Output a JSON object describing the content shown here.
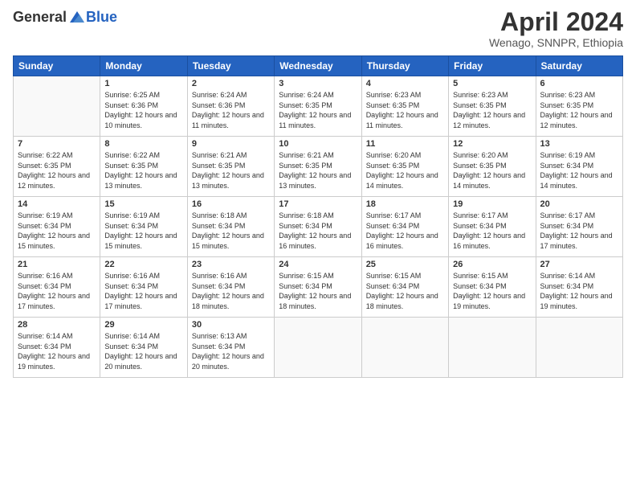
{
  "header": {
    "logo_general": "General",
    "logo_blue": "Blue",
    "main_title": "April 2024",
    "subtitle": "Wenago, SNNPR, Ethiopia"
  },
  "days_of_week": [
    "Sunday",
    "Monday",
    "Tuesday",
    "Wednesday",
    "Thursday",
    "Friday",
    "Saturday"
  ],
  "weeks": [
    [
      {
        "num": "",
        "sunrise": "",
        "sunset": "",
        "daylight": ""
      },
      {
        "num": "1",
        "sunrise": "Sunrise: 6:25 AM",
        "sunset": "Sunset: 6:36 PM",
        "daylight": "Daylight: 12 hours and 10 minutes."
      },
      {
        "num": "2",
        "sunrise": "Sunrise: 6:24 AM",
        "sunset": "Sunset: 6:36 PM",
        "daylight": "Daylight: 12 hours and 11 minutes."
      },
      {
        "num": "3",
        "sunrise": "Sunrise: 6:24 AM",
        "sunset": "Sunset: 6:35 PM",
        "daylight": "Daylight: 12 hours and 11 minutes."
      },
      {
        "num": "4",
        "sunrise": "Sunrise: 6:23 AM",
        "sunset": "Sunset: 6:35 PM",
        "daylight": "Daylight: 12 hours and 11 minutes."
      },
      {
        "num": "5",
        "sunrise": "Sunrise: 6:23 AM",
        "sunset": "Sunset: 6:35 PM",
        "daylight": "Daylight: 12 hours and 12 minutes."
      },
      {
        "num": "6",
        "sunrise": "Sunrise: 6:23 AM",
        "sunset": "Sunset: 6:35 PM",
        "daylight": "Daylight: 12 hours and 12 minutes."
      }
    ],
    [
      {
        "num": "7",
        "sunrise": "Sunrise: 6:22 AM",
        "sunset": "Sunset: 6:35 PM",
        "daylight": "Daylight: 12 hours and 12 minutes."
      },
      {
        "num": "8",
        "sunrise": "Sunrise: 6:22 AM",
        "sunset": "Sunset: 6:35 PM",
        "daylight": "Daylight: 12 hours and 13 minutes."
      },
      {
        "num": "9",
        "sunrise": "Sunrise: 6:21 AM",
        "sunset": "Sunset: 6:35 PM",
        "daylight": "Daylight: 12 hours and 13 minutes."
      },
      {
        "num": "10",
        "sunrise": "Sunrise: 6:21 AM",
        "sunset": "Sunset: 6:35 PM",
        "daylight": "Daylight: 12 hours and 13 minutes."
      },
      {
        "num": "11",
        "sunrise": "Sunrise: 6:20 AM",
        "sunset": "Sunset: 6:35 PM",
        "daylight": "Daylight: 12 hours and 14 minutes."
      },
      {
        "num": "12",
        "sunrise": "Sunrise: 6:20 AM",
        "sunset": "Sunset: 6:35 PM",
        "daylight": "Daylight: 12 hours and 14 minutes."
      },
      {
        "num": "13",
        "sunrise": "Sunrise: 6:19 AM",
        "sunset": "Sunset: 6:34 PM",
        "daylight": "Daylight: 12 hours and 14 minutes."
      }
    ],
    [
      {
        "num": "14",
        "sunrise": "Sunrise: 6:19 AM",
        "sunset": "Sunset: 6:34 PM",
        "daylight": "Daylight: 12 hours and 15 minutes."
      },
      {
        "num": "15",
        "sunrise": "Sunrise: 6:19 AM",
        "sunset": "Sunset: 6:34 PM",
        "daylight": "Daylight: 12 hours and 15 minutes."
      },
      {
        "num": "16",
        "sunrise": "Sunrise: 6:18 AM",
        "sunset": "Sunset: 6:34 PM",
        "daylight": "Daylight: 12 hours and 15 minutes."
      },
      {
        "num": "17",
        "sunrise": "Sunrise: 6:18 AM",
        "sunset": "Sunset: 6:34 PM",
        "daylight": "Daylight: 12 hours and 16 minutes."
      },
      {
        "num": "18",
        "sunrise": "Sunrise: 6:17 AM",
        "sunset": "Sunset: 6:34 PM",
        "daylight": "Daylight: 12 hours and 16 minutes."
      },
      {
        "num": "19",
        "sunrise": "Sunrise: 6:17 AM",
        "sunset": "Sunset: 6:34 PM",
        "daylight": "Daylight: 12 hours and 16 minutes."
      },
      {
        "num": "20",
        "sunrise": "Sunrise: 6:17 AM",
        "sunset": "Sunset: 6:34 PM",
        "daylight": "Daylight: 12 hours and 17 minutes."
      }
    ],
    [
      {
        "num": "21",
        "sunrise": "Sunrise: 6:16 AM",
        "sunset": "Sunset: 6:34 PM",
        "daylight": "Daylight: 12 hours and 17 minutes."
      },
      {
        "num": "22",
        "sunrise": "Sunrise: 6:16 AM",
        "sunset": "Sunset: 6:34 PM",
        "daylight": "Daylight: 12 hours and 17 minutes."
      },
      {
        "num": "23",
        "sunrise": "Sunrise: 6:16 AM",
        "sunset": "Sunset: 6:34 PM",
        "daylight": "Daylight: 12 hours and 18 minutes."
      },
      {
        "num": "24",
        "sunrise": "Sunrise: 6:15 AM",
        "sunset": "Sunset: 6:34 PM",
        "daylight": "Daylight: 12 hours and 18 minutes."
      },
      {
        "num": "25",
        "sunrise": "Sunrise: 6:15 AM",
        "sunset": "Sunset: 6:34 PM",
        "daylight": "Daylight: 12 hours and 18 minutes."
      },
      {
        "num": "26",
        "sunrise": "Sunrise: 6:15 AM",
        "sunset": "Sunset: 6:34 PM",
        "daylight": "Daylight: 12 hours and 19 minutes."
      },
      {
        "num": "27",
        "sunrise": "Sunrise: 6:14 AM",
        "sunset": "Sunset: 6:34 PM",
        "daylight": "Daylight: 12 hours and 19 minutes."
      }
    ],
    [
      {
        "num": "28",
        "sunrise": "Sunrise: 6:14 AM",
        "sunset": "Sunset: 6:34 PM",
        "daylight": "Daylight: 12 hours and 19 minutes."
      },
      {
        "num": "29",
        "sunrise": "Sunrise: 6:14 AM",
        "sunset": "Sunset: 6:34 PM",
        "daylight": "Daylight: 12 hours and 20 minutes."
      },
      {
        "num": "30",
        "sunrise": "Sunrise: 6:13 AM",
        "sunset": "Sunset: 6:34 PM",
        "daylight": "Daylight: 12 hours and 20 minutes."
      },
      {
        "num": "",
        "sunrise": "",
        "sunset": "",
        "daylight": ""
      },
      {
        "num": "",
        "sunrise": "",
        "sunset": "",
        "daylight": ""
      },
      {
        "num": "",
        "sunrise": "",
        "sunset": "",
        "daylight": ""
      },
      {
        "num": "",
        "sunrise": "",
        "sunset": "",
        "daylight": ""
      }
    ]
  ]
}
